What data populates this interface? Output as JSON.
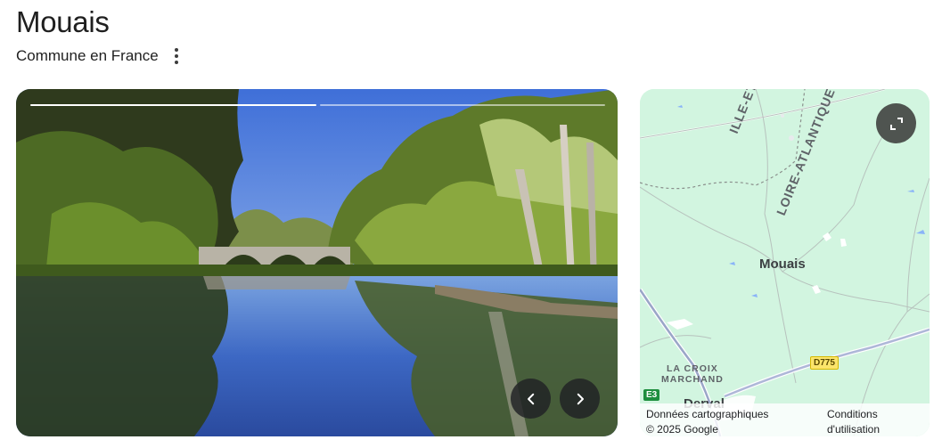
{
  "header": {
    "title": "Mouais",
    "subtitle": "Commune en France",
    "more_icon": "more-vert-icon"
  },
  "gallery": {
    "image_count": 2,
    "active_index": 0,
    "prev_icon": "chevron-left-icon",
    "next_icon": "chevron-right-icon"
  },
  "map": {
    "labels": {
      "ille": "ILLE-ET-VILAINE",
      "loire": "LOIRE-ATLANTIQUE",
      "mouais": "Mouais",
      "lacroix_line1": "LA CROIX",
      "lacroix_line2": "MARCHAND",
      "derval": "Derval"
    },
    "roads": {
      "d775": "D775",
      "e3": "E3"
    },
    "attribution": {
      "line1": "Données cartographiques",
      "line2": "© 2025 Google",
      "terms_line1": "Conditions",
      "terms_line2": "d'utilisation"
    },
    "expand_icon": "expand-icon"
  },
  "colors": {
    "map_land": "#d2f5e0",
    "road_badge": "#fbe56b",
    "e_road_badge": "#1e8e3e"
  }
}
